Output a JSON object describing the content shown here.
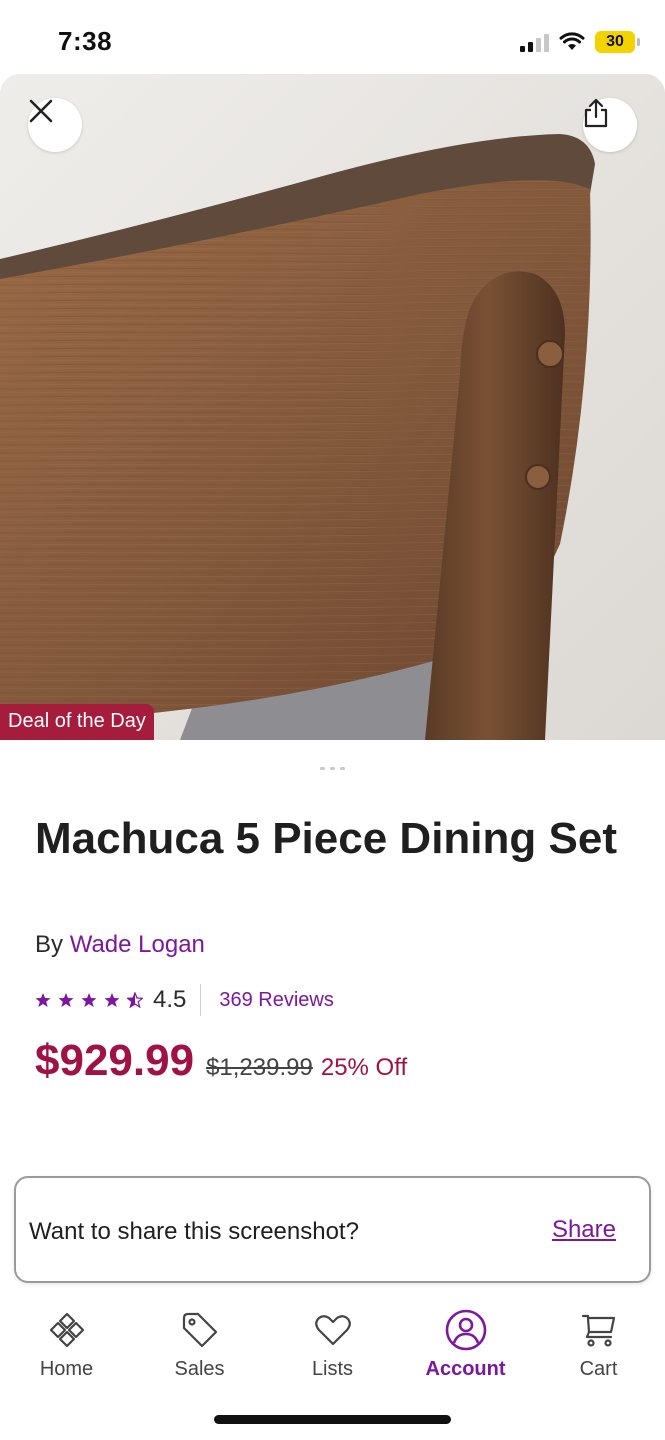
{
  "status_bar": {
    "time": "7:38",
    "battery": "30"
  },
  "hero": {
    "close_icon": "close-icon",
    "share_icon": "share-icon",
    "badge": "Deal of the Day"
  },
  "product": {
    "title": "Machuca 5 Piece Dining Set",
    "by_prefix": "By",
    "brand": "Wade Logan",
    "rating": "4.5",
    "rating_value": 4.5,
    "rating_max": 5,
    "reviews": "369 Reviews",
    "price": "$929.99",
    "original_price": "$1,239.99",
    "discount": "25% Off"
  },
  "share_toast": {
    "text": "Want to share this screenshot?",
    "action": "Share"
  },
  "tabs": [
    {
      "label": "Home",
      "icon": "home-icon",
      "active": false
    },
    {
      "label": "Sales",
      "icon": "tag-icon",
      "active": false
    },
    {
      "label": "Lists",
      "icon": "heart-icon",
      "active": false
    },
    {
      "label": "Account",
      "icon": "account-icon",
      "active": true
    },
    {
      "label": "Cart",
      "icon": "cart-icon",
      "active": false
    }
  ],
  "colors": {
    "brand_purple": "#7b189f",
    "price_red": "#a01246",
    "badge_red": "#a51c3d"
  }
}
